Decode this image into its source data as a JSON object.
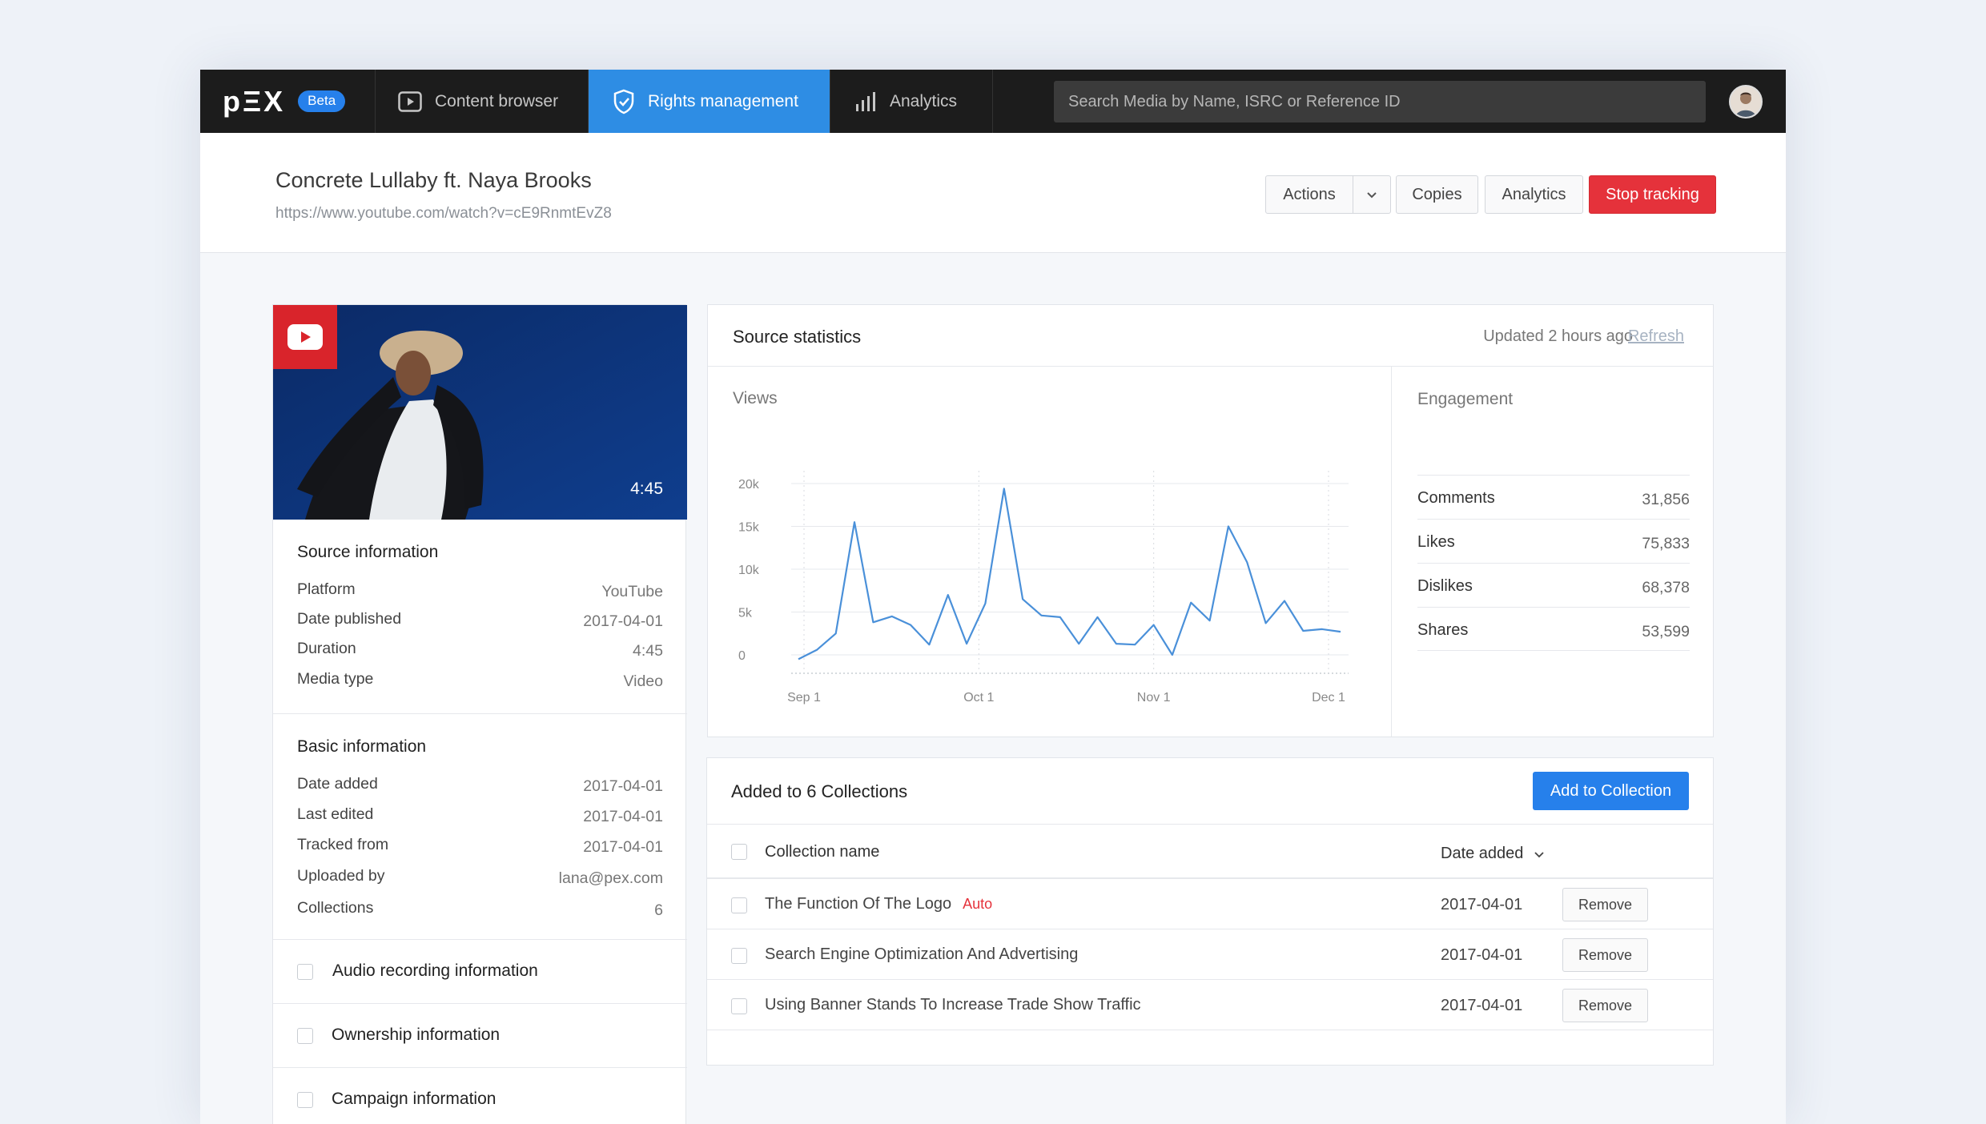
{
  "nav": {
    "logo": "pΞX",
    "beta": "Beta",
    "tabs": [
      {
        "label": "Content browser",
        "icon": "play-icon"
      },
      {
        "label": "Rights management",
        "icon": "shield-icon"
      },
      {
        "label": "Analytics",
        "icon": "bar-chart-icon"
      }
    ],
    "search_placeholder": "Search Media by Name, ISRC or Reference ID"
  },
  "header": {
    "title": "Concrete Lullaby ft. Naya Brooks",
    "url": "https://www.youtube.com/watch?v=cE9RnmtEvZ8",
    "actions_label": "Actions",
    "copies_label": "Copies",
    "analytics_label": "Analytics",
    "stop_label": "Stop tracking"
  },
  "media": {
    "duration": "4:45"
  },
  "source_info": {
    "title": "Source information",
    "rows": [
      {
        "label": "Platform",
        "value": "YouTube"
      },
      {
        "label": "Date published",
        "value": "2017-04-01"
      },
      {
        "label": "Duration",
        "value": "4:45"
      },
      {
        "label": "Media type",
        "value": "Video"
      }
    ]
  },
  "basic_info": {
    "title": "Basic information",
    "rows": [
      {
        "label": "Date added",
        "value": "2017-04-01"
      },
      {
        "label": "Last edited",
        "value": "2017-04-01"
      },
      {
        "label": "Tracked from",
        "value": "2017-04-01"
      },
      {
        "label": "Uploaded by",
        "value": "lana@pex.com"
      },
      {
        "label": "Collections",
        "value": "6"
      }
    ]
  },
  "collapsibles": [
    "Audio recording information",
    "Ownership information",
    "Campaign information"
  ],
  "stats": {
    "title": "Source statistics",
    "updated": "Updated 2 hours ago",
    "refresh": "Refresh",
    "views_title": "Views",
    "engagement_title": "Engagement",
    "engagement": [
      {
        "label": "Comments",
        "value": "31,856"
      },
      {
        "label": "Likes",
        "value": "75,833"
      },
      {
        "label": "Dislikes",
        "value": "68,378"
      },
      {
        "label": "Shares",
        "value": "53,599"
      }
    ]
  },
  "chart_data": {
    "type": "line",
    "title": "Views",
    "x_ticks": [
      "Sep 1",
      "Oct 1",
      "Nov 1",
      "Dec 1"
    ],
    "y_ticks": [
      "0",
      "5k",
      "10k",
      "15k",
      "20k"
    ],
    "ylim": [
      0,
      20000
    ],
    "series": [
      {
        "values": [
          -500,
          600,
          2500,
          15500,
          3800,
          4500,
          3500,
          1200,
          7000,
          1300,
          6000,
          19400,
          6500,
          4600,
          4400,
          1300,
          4400,
          1300,
          1200,
          3500,
          0,
          6100,
          4000,
          15000,
          10800,
          3700,
          6300,
          2800,
          3000,
          2700
        ]
      }
    ],
    "grid": true,
    "color": "#4a90d9"
  },
  "collections": {
    "title": "Added to 6 Collections",
    "add_label": "Add to Collection",
    "col_name": "Collection name",
    "col_date": "Date added",
    "remove_label": "Remove",
    "rows": [
      {
        "name": "The Function Of The Logo",
        "tag": "Auto",
        "date": "2017-04-01"
      },
      {
        "name": "Search Engine Optimization And Advertising",
        "tag": "",
        "date": "2017-04-01"
      },
      {
        "name": "Using Banner Stands To Increase Trade Show Traffic",
        "tag": "",
        "date": "2017-04-01"
      }
    ]
  }
}
